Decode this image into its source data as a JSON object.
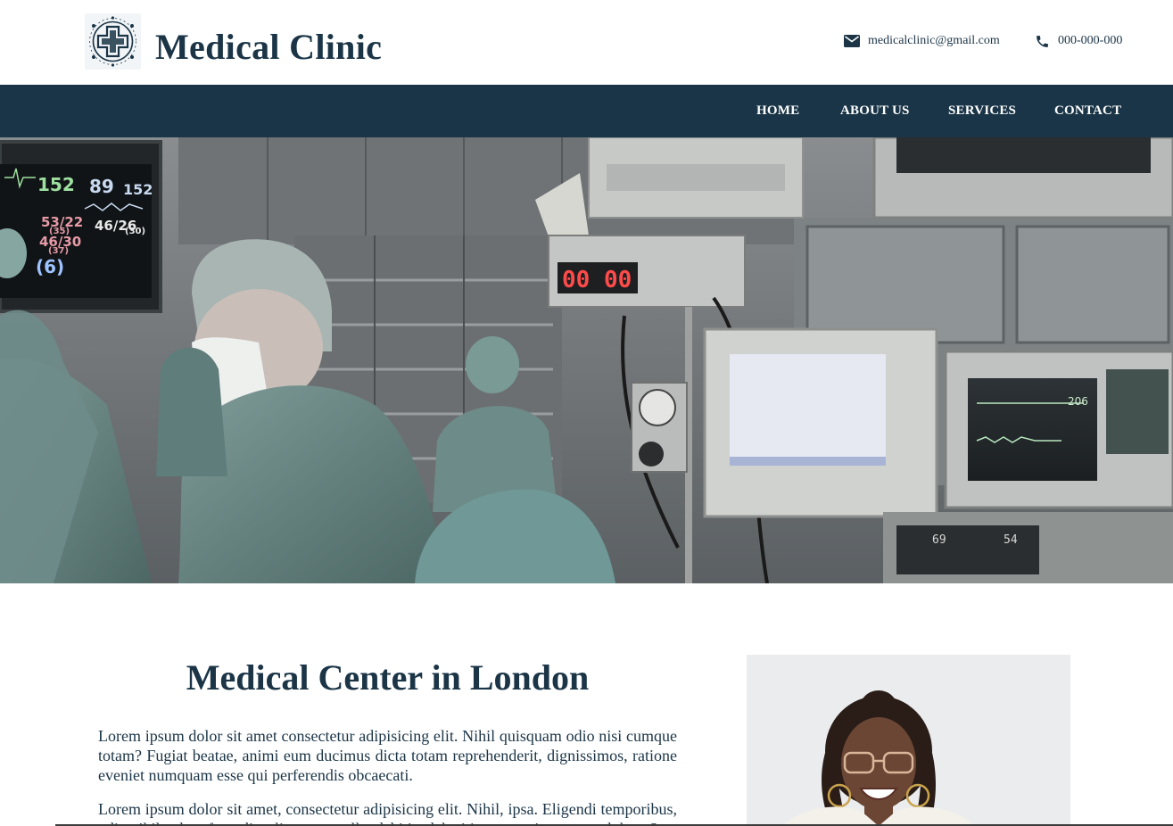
{
  "header": {
    "site_title": "Medical Clinic",
    "logo_icon": "medical-cross-logo-icon",
    "email": "medicalclinic@gmail.com",
    "email_icon": "envelope-icon",
    "phone": "000-000-000",
    "phone_icon": "phone-icon"
  },
  "nav": {
    "items": [
      {
        "label": "HOME"
      },
      {
        "label": "ABOUT US"
      },
      {
        "label": "SERVICES"
      },
      {
        "label": "CONTACT"
      }
    ]
  },
  "hero": {
    "monitor_readouts": [
      "152",
      "89",
      "152",
      "53/22",
      "(35)",
      "46/26",
      "(30)",
      "46/30",
      "(37)",
      "(6)",
      "00",
      "00",
      "206",
      "69",
      "54"
    ]
  },
  "main": {
    "title": "Medical Center in London",
    "paragraphs": [
      "Lorem ipsum dolor sit amet consectetur adipisicing elit. Nihil quisquam odio nisi cumque totam? Fugiat beatae, animi eum ducimus dicta totam reprehenderit, dignissimos, ratione eveniet numquam esse qui perferendis obcaecati.",
      "Lorem ipsum dolor sit amet, consectetur adipisicing elit. Nihil, ipsa. Eligendi temporibus, odio nihil, ad perferendis, aliquam repellat debitis, deleniti ut a possimus quas dolores?"
    ]
  },
  "colors": {
    "primary": "#1a3547",
    "text": "#1b3547",
    "background": "#ffffff"
  }
}
